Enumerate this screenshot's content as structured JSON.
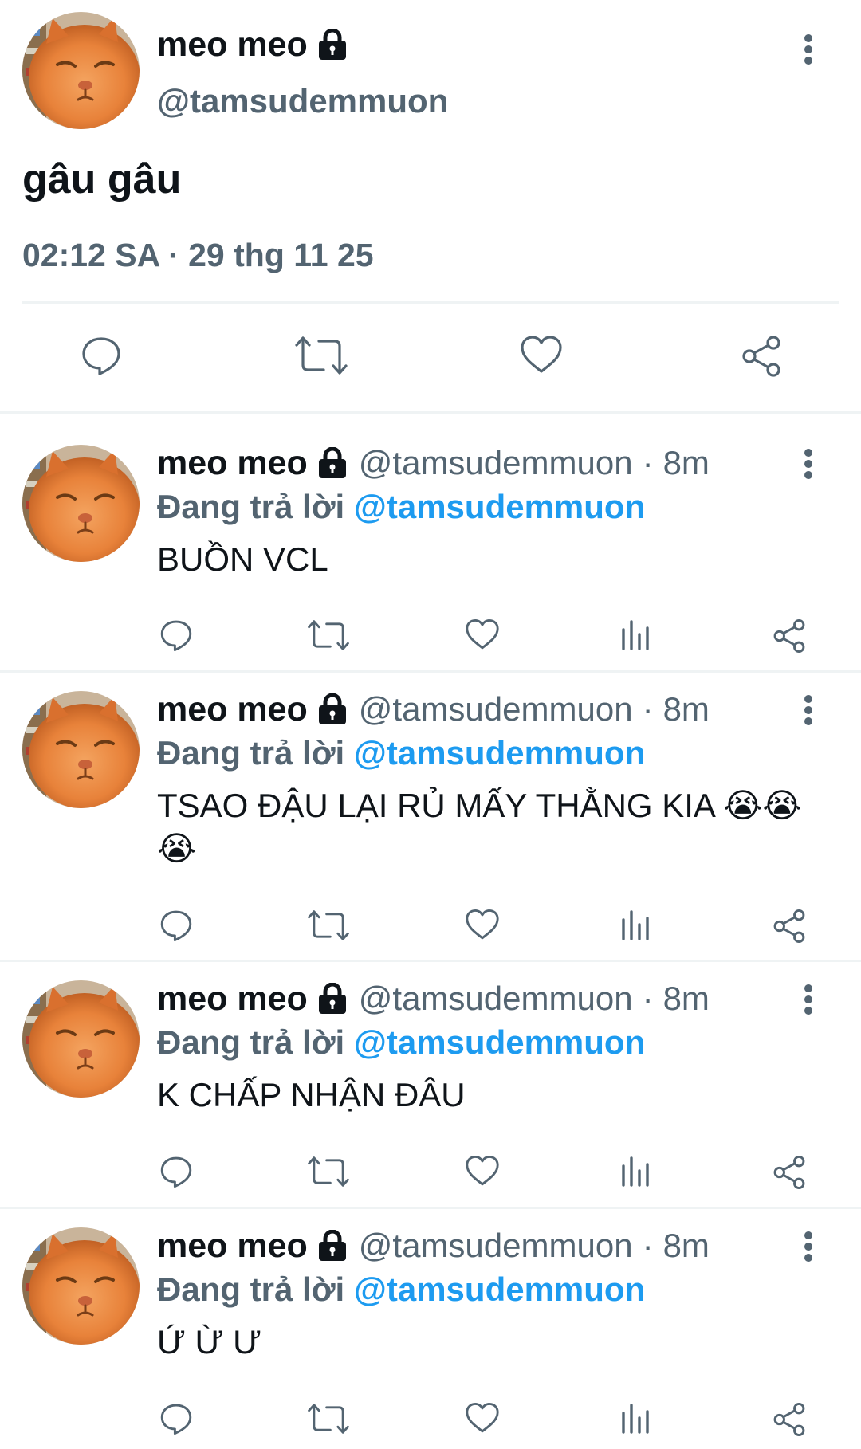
{
  "main_tweet": {
    "author_name": "meo meo",
    "handle": "@tamsudemmuon",
    "text": "gâu gâu",
    "timestamp": "02:12 SA · 29 thg 11 25",
    "icons": [
      "lock-icon",
      "more-vertical-icon",
      "reply-icon",
      "retweet-icon",
      "like-icon",
      "share-icon"
    ]
  },
  "replies": [
    {
      "author_name": "meo meo",
      "handle": "@tamsudemmuon",
      "separator": "·",
      "time": "8m",
      "replying_prefix": "Đang trả lời",
      "replying_to": "@tamsudemmuon",
      "text": "BUỒN VCL"
    },
    {
      "author_name": "meo meo",
      "handle": "@tamsudemmuon",
      "separator": "·",
      "time": "8m",
      "replying_prefix": "Đang trả lời",
      "replying_to": "@tamsudemmuon",
      "text": "TSAO ĐẬU LẠI RỦ MẤY THẰNG KIA 😭😭😭"
    },
    {
      "author_name": "meo meo",
      "handle": "@tamsudemmuon",
      "separator": "·",
      "time": "8m",
      "replying_prefix": "Đang trả lời",
      "replying_to": "@tamsudemmuon",
      "text": "K CHẤP NHẬN ĐÂU"
    },
    {
      "author_name": "meo meo",
      "handle": "@tamsudemmuon",
      "separator": "·",
      "time": "8m",
      "replying_prefix": "Đang trả lời",
      "replying_to": "@tamsudemmuon",
      "text": "Ứ Ừ Ư"
    }
  ],
  "reply_action_icons": [
    "reply-icon",
    "retweet-icon",
    "like-icon",
    "views-icon",
    "share-icon"
  ],
  "colors": {
    "text": "#0f1419",
    "secondary": "#536471",
    "link": "#1d9bf0",
    "divider": "#eff3f4",
    "avatar": "#e8823a"
  }
}
